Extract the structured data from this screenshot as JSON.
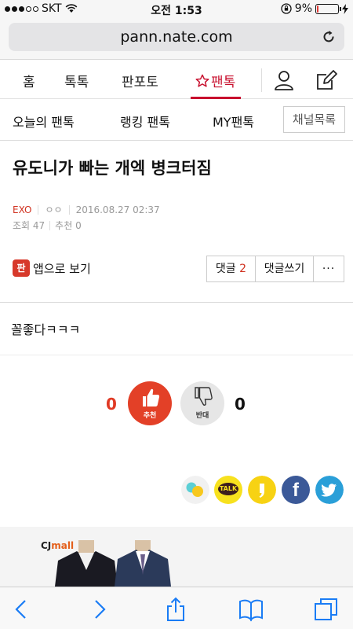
{
  "statusbar": {
    "carrier": "SKT",
    "time": "오전 1:53",
    "battery_pct": "9%",
    "battery_level": 0.09
  },
  "address": {
    "url": "pann.nate.com"
  },
  "topnav": {
    "items": [
      "홈",
      "톡톡",
      "판포토",
      "팬톡"
    ],
    "active": "팬톡"
  },
  "subnav": {
    "items": [
      "오늘의 팬톡",
      "랭킹 팬톡",
      "MY팬톡"
    ],
    "channel_button": "채널목록"
  },
  "article": {
    "title": "유도니가 빠는 개엑 병크터짐",
    "category": "EXO",
    "author": "ㅇㅇ",
    "date": "2016.08.27 02:37",
    "views": "조회 47",
    "recommends": "추천 0",
    "app_view": "앱으로 보기",
    "app_icon_text": "판",
    "comment_label": "댓글",
    "comment_count": "2",
    "write_comment": "댓글쓰기",
    "more": "···",
    "body": "꼴좋다ㅋㅋㅋ"
  },
  "vote": {
    "recommend_count": "0",
    "recommend_label": "추천",
    "oppose_count": "0",
    "oppose_label": "반대"
  },
  "share": {
    "kakaotalk_label": "TALK",
    "facebook_label": "f"
  },
  "ad": {
    "brand_prefix": "CJ",
    "brand_suffix": "mall"
  },
  "colors": {
    "accent": "#c8102e",
    "recommend": "#e34027",
    "kakao": "#f7e11e",
    "facebook": "#3b5998",
    "twitter": "#2a9fd8"
  }
}
